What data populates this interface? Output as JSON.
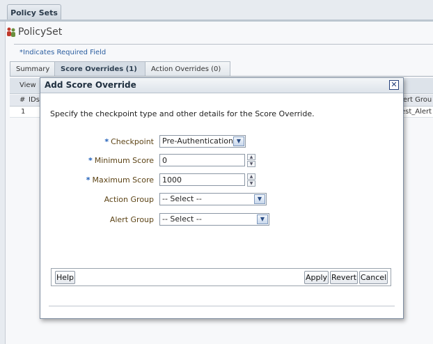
{
  "page": {
    "tab_label": "Policy Sets",
    "title": "PolicySet",
    "required_note": "*Indicates Required Field",
    "tabs": [
      {
        "label": "Summary"
      },
      {
        "label": "Score Overrides (1)"
      },
      {
        "label": "Action Overrides (0)"
      }
    ],
    "toolbar_view": "View",
    "table": {
      "headers": [
        "#",
        "IDs",
        "lert Grou"
      ],
      "rows": [
        [
          "1",
          "",
          "est_Alert"
        ]
      ]
    }
  },
  "dialog": {
    "title": "Add Score Override",
    "close_glyph": "✕",
    "instructions": "Specify the checkpoint type and other details for the Score Override.",
    "required_marker": "*",
    "fields": {
      "checkpoint": {
        "label": "Checkpoint",
        "value": "Pre-Authentication"
      },
      "min_score": {
        "label": "Minimum Score",
        "value": "0"
      },
      "max_score": {
        "label": "Maximum Score",
        "value": "1000"
      },
      "action_group": {
        "label": "Action Group",
        "value": "-- Select --"
      },
      "alert_group": {
        "label": "Alert Group",
        "value": "-- Select --"
      }
    },
    "buttons": {
      "help": "Help",
      "apply": "Apply",
      "revert": "Revert",
      "cancel": "Cancel"
    }
  },
  "glyphs": {
    "dropdown": "▼",
    "spin_up": "▲",
    "spin_down": "▼"
  },
  "colors": {
    "accent": "#1d5db8",
    "label": "#5d4416",
    "close_border": "#233f7a"
  }
}
